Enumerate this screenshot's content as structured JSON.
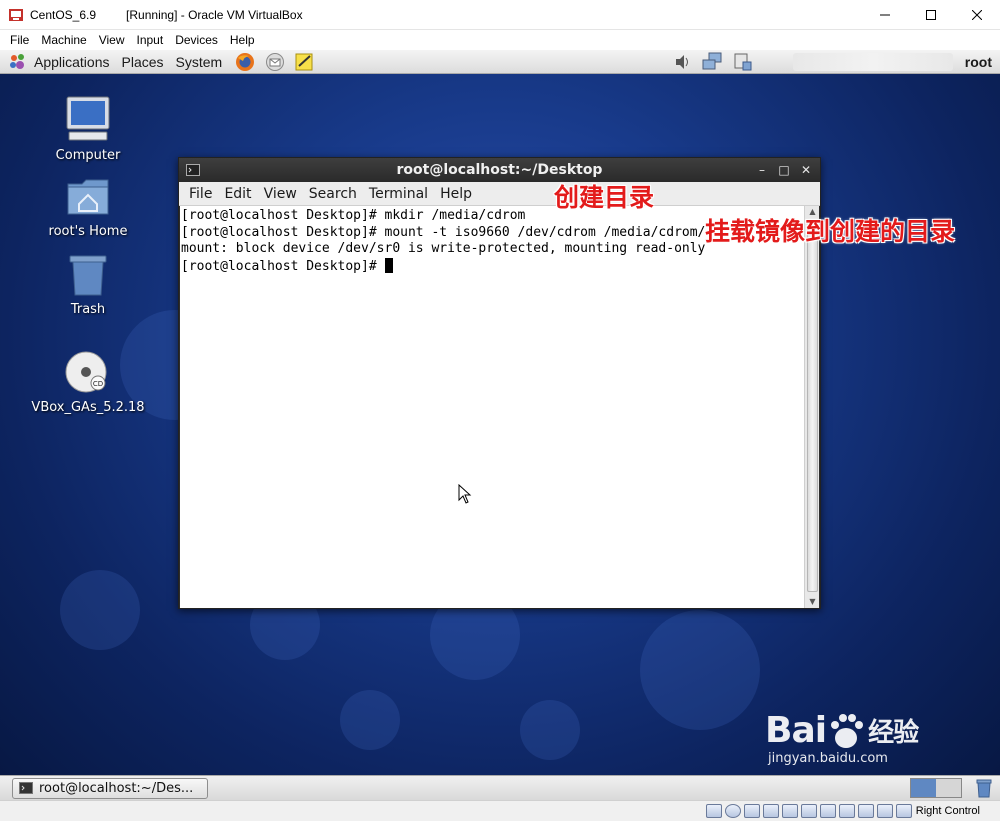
{
  "host_window": {
    "title": "CentOS_6.9         [Running] - Oracle VM VirtualBox",
    "menu": [
      "File",
      "Machine",
      "View",
      "Input",
      "Devices",
      "Help"
    ]
  },
  "gnome_panel": {
    "menus": [
      "Applications",
      "Places",
      "System"
    ],
    "user": "root"
  },
  "desktop_icons": [
    {
      "label": "Computer",
      "icon": "computer-icon"
    },
    {
      "label": "root's Home",
      "icon": "home-folder-icon"
    },
    {
      "label": "Trash",
      "icon": "trash-icon"
    },
    {
      "label": "VBox_GAs_5.2.18",
      "icon": "cd-icon"
    }
  ],
  "terminal": {
    "title": "root@localhost:~/Desktop",
    "menu": [
      "File",
      "Edit",
      "View",
      "Search",
      "Terminal",
      "Help"
    ],
    "lines": [
      "[root@localhost Desktop]# mkdir /media/cdrom",
      "[root@localhost Desktop]# mount -t iso9660 /dev/cdrom /media/cdrom/",
      "mount: block device /dev/sr0 is write-protected, mounting read-only",
      "[root@localhost Desktop]# "
    ]
  },
  "annotations": {
    "create_dir": "创建目录",
    "mount_image": "挂载镜像到创建的目录"
  },
  "taskbar": {
    "window_button": "root@localhost:~/Des..."
  },
  "watermark": {
    "brand": "Bai",
    "brand2": "经验",
    "url": "jingyan.baidu.com"
  },
  "vb_status": {
    "host_key": "Right Control"
  },
  "colors": {
    "annotation": "#e31b1b",
    "desktop_bg": "#183a8a"
  }
}
